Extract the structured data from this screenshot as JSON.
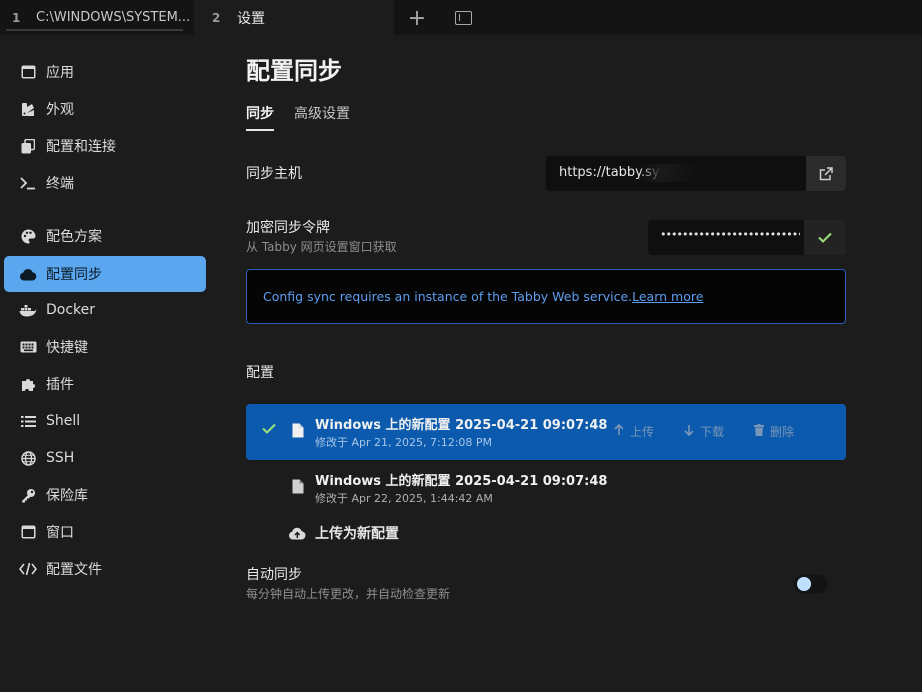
{
  "tabs": [
    {
      "num": "1",
      "title": "C:\\WINDOWS\\SYSTEM..."
    },
    {
      "num": "2",
      "title": "设置"
    }
  ],
  "tab_actions": {
    "new_tab": "+"
  },
  "sidebar": {
    "items": [
      {
        "label": "应用",
        "icon": "app-window-icon"
      },
      {
        "label": "外观",
        "icon": "paint-icon"
      },
      {
        "label": "配置和连接",
        "icon": "copy-icon"
      },
      {
        "label": "终端",
        "icon": "terminal-icon"
      },
      {
        "label": "配色方案",
        "icon": "palette-icon"
      },
      {
        "label": "配置同步",
        "icon": "cloud-icon",
        "active": true
      },
      {
        "label": "Docker",
        "icon": "docker-icon"
      },
      {
        "label": "快捷键",
        "icon": "keyboard-icon"
      },
      {
        "label": "插件",
        "icon": "puzzle-icon"
      },
      {
        "label": "Shell",
        "icon": "list-icon"
      },
      {
        "label": "SSH",
        "icon": "globe-icon"
      },
      {
        "label": "保险库",
        "icon": "key-icon"
      },
      {
        "label": "窗口",
        "icon": "window-icon"
      },
      {
        "label": "配置文件",
        "icon": "code-icon"
      }
    ]
  },
  "main": {
    "title": "配置同步",
    "subtabs": [
      "同步",
      "高级设置"
    ],
    "host": {
      "label": "同步主机",
      "value": "https://tabby.sy"
    },
    "token": {
      "label": "加密同步令牌",
      "hint": "从 Tabby 网页设置窗口获取",
      "value": "••••••••••••••••••••••••••••••••••••••"
    },
    "alert": {
      "text": "Config sync requires an instance of the Tabby Web service.",
      "link": "Learn more"
    },
    "configs_heading": "配置",
    "configs": [
      {
        "name": "Windows 上的新配置 2025-04-21 09:07:48",
        "modified_prefix": "修改于",
        "modified": "Apr 21, 2025, 7:12:08 PM",
        "selected": true,
        "actions": [
          "上传",
          "下载",
          "删除"
        ]
      },
      {
        "name": "Windows 上的新配置 2025-04-21 09:07:48",
        "modified_prefix": "修改于",
        "modified": "Apr 22, 2025, 1:44:42 AM",
        "selected": false
      }
    ],
    "upload_new": "上传为新配置",
    "auto_sync": {
      "label": "自动同步",
      "hint": "每分钟自动上传更改，并自动检查更新",
      "enabled": false
    }
  },
  "colors": {
    "accent": "#5aa7f0",
    "selected_row": "#0b5aad",
    "check": "#9ee07a",
    "alert_border": "#2d5db8"
  }
}
